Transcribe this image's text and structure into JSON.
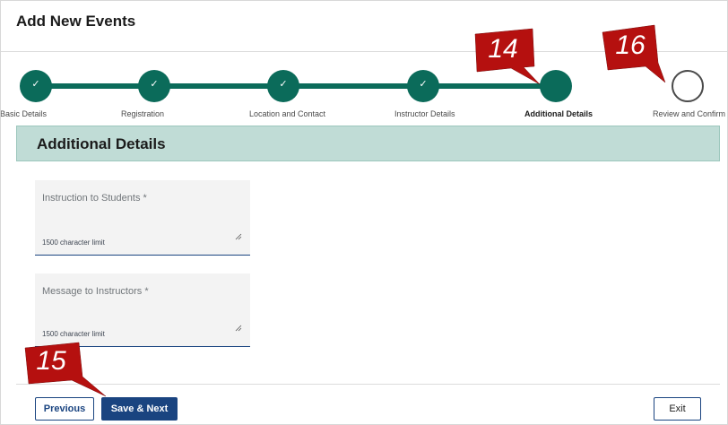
{
  "page": {
    "title": "Add New Events"
  },
  "stepper": {
    "steps": [
      {
        "label": "Basic Details",
        "state": "done"
      },
      {
        "label": "Registration",
        "state": "done"
      },
      {
        "label": "Location and Contact",
        "state": "done"
      },
      {
        "label": "Instructor Details",
        "state": "done"
      },
      {
        "label": "Additional Details",
        "state": "current"
      },
      {
        "label": "Review and Confirm",
        "state": "todo"
      }
    ],
    "check_glyph": "✓"
  },
  "callouts": {
    "a": "14",
    "b": "16",
    "c": "15"
  },
  "section": {
    "title": "Additional Details"
  },
  "fields": {
    "instruction": {
      "label": "Instruction to Students",
      "required_mark": "*",
      "limit": "1500 character limit"
    },
    "message": {
      "label": "Message to Instructors",
      "required_mark": "*",
      "limit": "1500 character limit"
    }
  },
  "buttons": {
    "previous": "Previous",
    "save_next": "Save & Next",
    "exit": "Exit"
  },
  "colors": {
    "stepper_done": "#0b6b5a",
    "section_bg": "#c0dcd6",
    "primary": "#1a4480",
    "callout": "#b5100f"
  }
}
